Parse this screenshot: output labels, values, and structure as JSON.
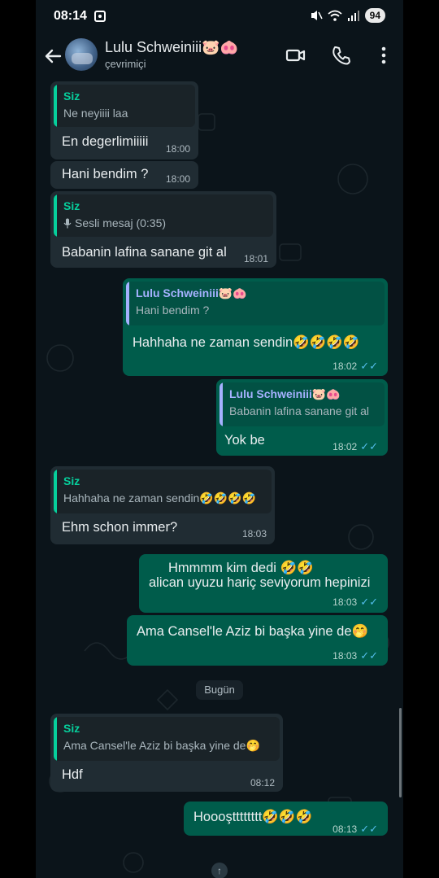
{
  "status_bar": {
    "time": "08:14",
    "battery": "94"
  },
  "header": {
    "contact_name": "Lulu Schweiniii🐷🐽",
    "contact_status": "çevrimiçi"
  },
  "messages": [
    {
      "quote_author": "Siz",
      "quote_text": "Ne neyiiii laa",
      "text": "En degerlimiiiii",
      "time": "18:00"
    },
    {
      "text": "Hani bendim ?",
      "time": "18:00"
    },
    {
      "quote_author": "Siz",
      "quote_text": "Sesli mesaj (0:35)",
      "text": "Babanin lafina sanane git al",
      "time": "18:01"
    },
    {
      "quote_author": "Lulu Schweiniii🐷🐽",
      "quote_text": "Hani bendim ?",
      "text": "Hahhaha ne zaman sendin🤣🤣🤣🤣",
      "time": "18:02"
    },
    {
      "quote_author": "Lulu Schweiniii🐷🐽",
      "quote_text": "Babanin lafina sanane git al",
      "text": "Yok be",
      "time": "18:02"
    },
    {
      "quote_author": "Siz",
      "quote_text": "Hahhaha ne zaman sendin🤣🤣🤣🤣",
      "text": "Ehm schon immer?",
      "time": "18:03"
    },
    {
      "text_line1": "Hmmmm kim dedi 🤣🤣",
      "text_line2": "alican uyuzu hariç seviyorum hepinizi",
      "time": "18:03"
    },
    {
      "text": "Ama Cansel'le Aziz bi başka yine de🤭",
      "time": "18:03"
    },
    {
      "quote_author": "Siz",
      "quote_text": "Ama Cansel'le Aziz bi başka yine de🤭",
      "text": "Hdf",
      "time": "08:12"
    },
    {
      "text": "Hoooştttttttt🤣🤣🤣",
      "time": "08:13"
    }
  ],
  "date_divider": "Bugün",
  "colors": {
    "background": "#0b141a",
    "incoming_bubble": "#202c33",
    "outgoing_bubble": "#005c4b",
    "quote_accent_self": "#06cf9c",
    "quote_accent_contact": "#a5b1ff",
    "read_ticks": "#53bdeb"
  },
  "icons": [
    "back-arrow-icon",
    "video-call-icon",
    "voice-call-icon",
    "more-options-icon",
    "microphone-icon",
    "double-check-icon",
    "scroll-down-icon"
  ]
}
